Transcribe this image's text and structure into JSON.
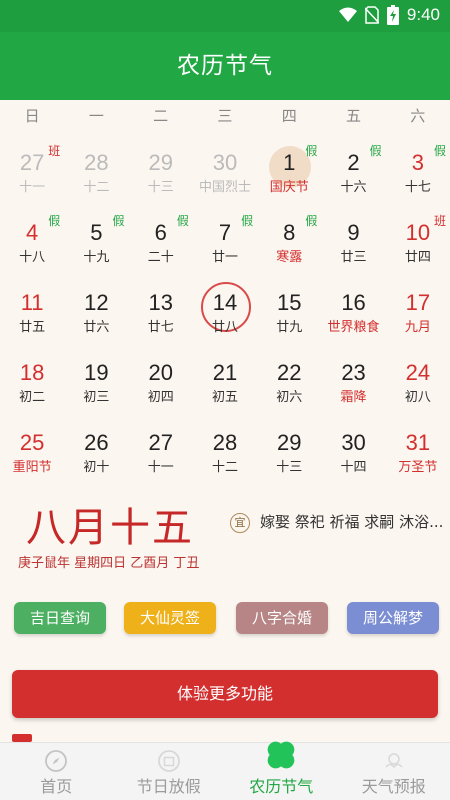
{
  "status": {
    "time": "9:40"
  },
  "header": {
    "title": "农历节气"
  },
  "weekdays": [
    "日",
    "一",
    "二",
    "三",
    "四",
    "五",
    "六"
  ],
  "calendar": {
    "rows": [
      [
        {
          "num": "27",
          "lunar": "十一",
          "badge": "班",
          "badge_type": "ban",
          "muted": true
        },
        {
          "num": "28",
          "lunar": "十二",
          "muted": true
        },
        {
          "num": "29",
          "lunar": "十三",
          "muted": true
        },
        {
          "num": "30",
          "lunar": "中国烈士",
          "muted": true
        },
        {
          "num": "1",
          "lunar": "国庆节",
          "lunar_red": true,
          "badge": "假",
          "badge_type": "jia",
          "selected": true
        },
        {
          "num": "2",
          "lunar": "十六",
          "badge": "假",
          "badge_type": "jia"
        },
        {
          "num": "3",
          "lunar": "十七",
          "badge": "假",
          "badge_type": "jia",
          "weekend": true
        }
      ],
      [
        {
          "num": "4",
          "lunar": "十八",
          "badge": "假",
          "badge_type": "jia",
          "weekend": true
        },
        {
          "num": "5",
          "lunar": "十九",
          "badge": "假",
          "badge_type": "jia"
        },
        {
          "num": "6",
          "lunar": "二十",
          "badge": "假",
          "badge_type": "jia"
        },
        {
          "num": "7",
          "lunar": "廿一",
          "badge": "假",
          "badge_type": "jia"
        },
        {
          "num": "8",
          "lunar": "寒露",
          "lunar_red": true,
          "badge": "假",
          "badge_type": "jia"
        },
        {
          "num": "9",
          "lunar": "廿三"
        },
        {
          "num": "10",
          "lunar": "廿四",
          "badge": "班",
          "badge_type": "ban",
          "weekend": true
        }
      ],
      [
        {
          "num": "11",
          "lunar": "廿五",
          "weekend": true
        },
        {
          "num": "12",
          "lunar": "廿六"
        },
        {
          "num": "13",
          "lunar": "廿七"
        },
        {
          "num": "14",
          "lunar": "廿八",
          "today": true
        },
        {
          "num": "15",
          "lunar": "廿九"
        },
        {
          "num": "16",
          "lunar": "世界粮食",
          "lunar_red": true
        },
        {
          "num": "17",
          "lunar": "九月",
          "lunar_red": true,
          "weekend": true
        }
      ],
      [
        {
          "num": "18",
          "lunar": "初二",
          "weekend": true
        },
        {
          "num": "19",
          "lunar": "初三"
        },
        {
          "num": "20",
          "lunar": "初四"
        },
        {
          "num": "21",
          "lunar": "初五"
        },
        {
          "num": "22",
          "lunar": "初六"
        },
        {
          "num": "23",
          "lunar": "霜降",
          "lunar_red": true
        },
        {
          "num": "24",
          "lunar": "初八",
          "weekend": true
        }
      ],
      [
        {
          "num": "25",
          "lunar": "重阳节",
          "lunar_red": true,
          "weekend": true
        },
        {
          "num": "26",
          "lunar": "初十"
        },
        {
          "num": "27",
          "lunar": "十一"
        },
        {
          "num": "28",
          "lunar": "十二"
        },
        {
          "num": "29",
          "lunar": "十三"
        },
        {
          "num": "30",
          "lunar": "十四"
        },
        {
          "num": "31",
          "lunar": "万圣节",
          "lunar_red": true,
          "weekend": true
        }
      ]
    ]
  },
  "info": {
    "lunar_date": "八月十五",
    "ganzhi": "庚子鼠年 星期四日 乙酉月 丁丑",
    "yi_label": "宜",
    "yi_text": "嫁娶 祭祀 祈福 求嗣 沐浴..."
  },
  "quick_buttons": [
    "吉日查询",
    "大仙灵签",
    "八字合婚",
    "周公解梦"
  ],
  "more_button": "体验更多功能",
  "nav": [
    {
      "label": "首页"
    },
    {
      "label": "节日放假"
    },
    {
      "label": "农历节气",
      "active": true
    },
    {
      "label": "天气预报"
    }
  ]
}
